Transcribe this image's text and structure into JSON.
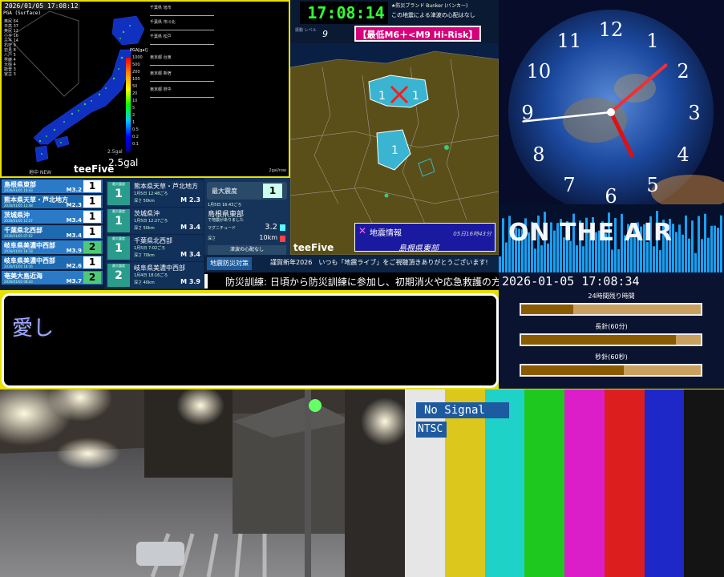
{
  "pga": {
    "timestamp": "2026/01/05 17:08:12",
    "mode": "PGA (Surface)",
    "scale_title": "PGA[gal]",
    "scale_ticks": [
      "1000",
      "500",
      "200",
      "100",
      "50",
      "20",
      "10",
      "5",
      "2",
      "1",
      "0.5",
      "0.2",
      "0.1"
    ],
    "gal_small": "2.5gal",
    "gal": "2.5gal",
    "logo": "teeFive",
    "tag": "地中 NEW",
    "unit": "2gal/row",
    "stations": [
      "千葉県 旭市",
      "千葉県 市川北",
      "千葉県 松戸",
      "東京都 台東",
      "東京都 新宿",
      "東京都 府中"
    ]
  },
  "eq_list": [
    {
      "name": "島根県東部",
      "date": "2026/01/05 16:43",
      "mag": "M3.2",
      "shindo": "1",
      "color": "#ffffff"
    },
    {
      "name": "熊本県天草・芦北地方",
      "date": "2026/01/05 12:48",
      "mag": "M2.3",
      "shindo": "1",
      "color": "#ffffff"
    },
    {
      "name": "茨城県沖",
      "date": "2026/01/05 12:27",
      "mag": "M3.4",
      "shindo": "1",
      "color": "#ffffff"
    },
    {
      "name": "千葉県北西部",
      "date": "2026/01/05 07:02",
      "mag": "M3.4",
      "shindo": "1",
      "color": "#ffffff"
    },
    {
      "name": "岐阜県美濃中西部",
      "date": "2026/01/04 18:18",
      "mag": "M3.9",
      "shindo": "2",
      "color": "#4ec97a"
    },
    {
      "name": "岐阜県美濃中西部",
      "date": "2026/01/04 18:16",
      "mag": "M2.6",
      "shindo": "1",
      "color": "#ffffff"
    },
    {
      "name": "奄美大島近海",
      "date": "2026/01/02 08:43",
      "mag": "M3.7",
      "shindo": "2",
      "color": "#4ec97a"
    }
  ],
  "eq_detail": [
    {
      "label": "最大震度",
      "shindo": "1",
      "name": "熊本県天草・芦北地方",
      "time": "1月5日 12:48ごろ",
      "depth": "深さ 50km",
      "mag": "M 2.3"
    },
    {
      "label": "最大震度",
      "shindo": "1",
      "name": "茨城県沖",
      "time": "1月5日 12:27ごろ",
      "depth": "深さ 50km",
      "mag": "M 3.4"
    },
    {
      "label": "最大震度",
      "shindo": "1",
      "name": "千葉県北西部",
      "time": "1月5日 7:02ごろ",
      "depth": "深さ 70km",
      "mag": "M 3.4"
    },
    {
      "label": "最大震度",
      "shindo": "2",
      "name": "岐阜県美濃中西部",
      "time": "1月4日 18:16ごろ",
      "depth": "深さ 40km",
      "mag": "M 3.9"
    }
  ],
  "max_panel": {
    "title": "最大震度",
    "value": "1",
    "time": "1月5日 16:43ごろ",
    "location": "島根県東部",
    "note_small": "で地震がありました",
    "mag_label": "マグニチュード",
    "mag": "3.2",
    "depth_label": "深さ",
    "depth": "10km",
    "tsunami": "津波の心配なし"
  },
  "ticker1": {
    "badge": "地震防災対策",
    "msg": "謹賀新年2026　いつも「地震ライブ」をご視聴頂きありがとうございます!"
  },
  "ticker2": {
    "msg": "防災訓練: 日頃から防災訓練に参加し、初期消火や応急救護の方法"
  },
  "seis": {
    "clock": "17:08:14",
    "announce1": "★防災ブランド Bunker (バンカー)",
    "announce2": "この地震による津波の心配はなし",
    "level_label": "振動 レベル",
    "level": "9",
    "risk": "【最低M6＋<M9 Hi-Risk】",
    "logo": "teeFive",
    "info_title": "地震情報",
    "info_date": "05日16時43分",
    "info_loc": "島根県東部",
    "shindo_marks": [
      "1",
      "1",
      "1"
    ]
  },
  "clock": {
    "numbers": [
      "12",
      "1",
      "2",
      "3",
      "4",
      "5",
      "6",
      "7",
      "8",
      "9",
      "10",
      "11"
    ],
    "hour": 5,
    "minute": 8,
    "second": 14
  },
  "viz": {
    "text": "ON THE AIR"
  },
  "timer": {
    "date": "2026-01-05 17:08:34",
    "bars": [
      {
        "label": "24時間残り時間",
        "fill": 0.29
      },
      {
        "label": "長針(60分)",
        "fill": 0.86
      },
      {
        "label": "秒針(60秒)",
        "fill": 0.57
      }
    ]
  },
  "subtitle": {
    "text": "愛し"
  },
  "bars": {
    "no_signal": "No Signal",
    "ntsc": "NTSC",
    "colors": [
      "#e6e6e6",
      "#dcc81c",
      "#1ed2c8",
      "#1ec81e",
      "#dc1ec8",
      "#dc1e1e",
      "#1e28c8",
      "#141414"
    ]
  }
}
